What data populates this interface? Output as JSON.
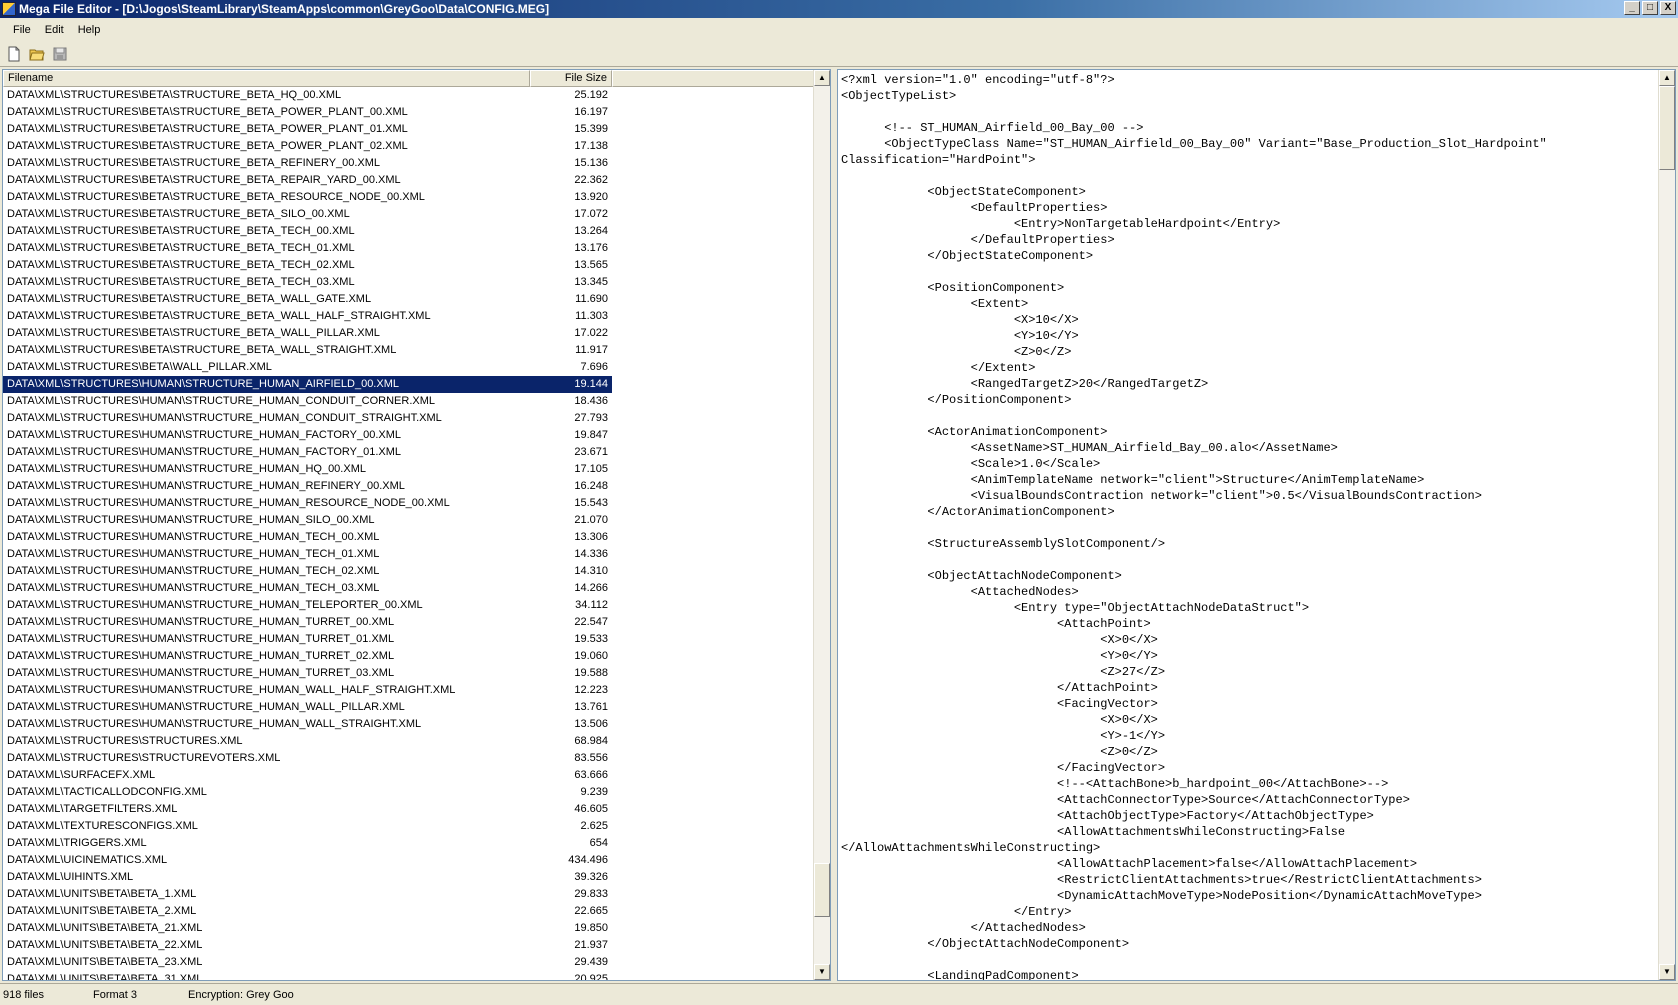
{
  "window": {
    "title": "Mega File Editor - [D:\\Jogos\\SteamLibrary\\SteamApps\\common\\GreyGoo\\Data\\CONFIG.MEG]",
    "controls": [
      "_",
      "□",
      "X"
    ]
  },
  "menu": {
    "file": "File",
    "edit": "Edit",
    "help": "Help"
  },
  "toolbar": {
    "icons": [
      "new-file-icon",
      "open-folder-icon",
      "save-icon"
    ]
  },
  "file_list": {
    "columns": {
      "filename": "Filename",
      "filesize": "File Size"
    },
    "selected_index": 17,
    "rows": [
      {
        "name": "DATA\\XML\\STRUCTURES\\BETA\\STRUCTURE_BETA_HQ_00.XML",
        "size": "25.192"
      },
      {
        "name": "DATA\\XML\\STRUCTURES\\BETA\\STRUCTURE_BETA_POWER_PLANT_00.XML",
        "size": "16.197"
      },
      {
        "name": "DATA\\XML\\STRUCTURES\\BETA\\STRUCTURE_BETA_POWER_PLANT_01.XML",
        "size": "15.399"
      },
      {
        "name": "DATA\\XML\\STRUCTURES\\BETA\\STRUCTURE_BETA_POWER_PLANT_02.XML",
        "size": "17.138"
      },
      {
        "name": "DATA\\XML\\STRUCTURES\\BETA\\STRUCTURE_BETA_REFINERY_00.XML",
        "size": "15.136"
      },
      {
        "name": "DATA\\XML\\STRUCTURES\\BETA\\STRUCTURE_BETA_REPAIR_YARD_00.XML",
        "size": "22.362"
      },
      {
        "name": "DATA\\XML\\STRUCTURES\\BETA\\STRUCTURE_BETA_RESOURCE_NODE_00.XML",
        "size": "13.920"
      },
      {
        "name": "DATA\\XML\\STRUCTURES\\BETA\\STRUCTURE_BETA_SILO_00.XML",
        "size": "17.072"
      },
      {
        "name": "DATA\\XML\\STRUCTURES\\BETA\\STRUCTURE_BETA_TECH_00.XML",
        "size": "13.264"
      },
      {
        "name": "DATA\\XML\\STRUCTURES\\BETA\\STRUCTURE_BETA_TECH_01.XML",
        "size": "13.176"
      },
      {
        "name": "DATA\\XML\\STRUCTURES\\BETA\\STRUCTURE_BETA_TECH_02.XML",
        "size": "13.565"
      },
      {
        "name": "DATA\\XML\\STRUCTURES\\BETA\\STRUCTURE_BETA_TECH_03.XML",
        "size": "13.345"
      },
      {
        "name": "DATA\\XML\\STRUCTURES\\BETA\\STRUCTURE_BETA_WALL_GATE.XML",
        "size": "11.690"
      },
      {
        "name": "DATA\\XML\\STRUCTURES\\BETA\\STRUCTURE_BETA_WALL_HALF_STRAIGHT.XML",
        "size": "11.303"
      },
      {
        "name": "DATA\\XML\\STRUCTURES\\BETA\\STRUCTURE_BETA_WALL_PILLAR.XML",
        "size": "17.022"
      },
      {
        "name": "DATA\\XML\\STRUCTURES\\BETA\\STRUCTURE_BETA_WALL_STRAIGHT.XML",
        "size": "11.917"
      },
      {
        "name": "DATA\\XML\\STRUCTURES\\BETA\\WALL_PILLAR.XML",
        "size": "7.696"
      },
      {
        "name": "DATA\\XML\\STRUCTURES\\HUMAN\\STRUCTURE_HUMAN_AIRFIELD_00.XML",
        "size": "19.144"
      },
      {
        "name": "DATA\\XML\\STRUCTURES\\HUMAN\\STRUCTURE_HUMAN_CONDUIT_CORNER.XML",
        "size": "18.436"
      },
      {
        "name": "DATA\\XML\\STRUCTURES\\HUMAN\\STRUCTURE_HUMAN_CONDUIT_STRAIGHT.XML",
        "size": "27.793"
      },
      {
        "name": "DATA\\XML\\STRUCTURES\\HUMAN\\STRUCTURE_HUMAN_FACTORY_00.XML",
        "size": "19.847"
      },
      {
        "name": "DATA\\XML\\STRUCTURES\\HUMAN\\STRUCTURE_HUMAN_FACTORY_01.XML",
        "size": "23.671"
      },
      {
        "name": "DATA\\XML\\STRUCTURES\\HUMAN\\STRUCTURE_HUMAN_HQ_00.XML",
        "size": "17.105"
      },
      {
        "name": "DATA\\XML\\STRUCTURES\\HUMAN\\STRUCTURE_HUMAN_REFINERY_00.XML",
        "size": "16.248"
      },
      {
        "name": "DATA\\XML\\STRUCTURES\\HUMAN\\STRUCTURE_HUMAN_RESOURCE_NODE_00.XML",
        "size": "15.543"
      },
      {
        "name": "DATA\\XML\\STRUCTURES\\HUMAN\\STRUCTURE_HUMAN_SILO_00.XML",
        "size": "21.070"
      },
      {
        "name": "DATA\\XML\\STRUCTURES\\HUMAN\\STRUCTURE_HUMAN_TECH_00.XML",
        "size": "13.306"
      },
      {
        "name": "DATA\\XML\\STRUCTURES\\HUMAN\\STRUCTURE_HUMAN_TECH_01.XML",
        "size": "14.336"
      },
      {
        "name": "DATA\\XML\\STRUCTURES\\HUMAN\\STRUCTURE_HUMAN_TECH_02.XML",
        "size": "14.310"
      },
      {
        "name": "DATA\\XML\\STRUCTURES\\HUMAN\\STRUCTURE_HUMAN_TECH_03.XML",
        "size": "14.266"
      },
      {
        "name": "DATA\\XML\\STRUCTURES\\HUMAN\\STRUCTURE_HUMAN_TELEPORTER_00.XML",
        "size": "34.112"
      },
      {
        "name": "DATA\\XML\\STRUCTURES\\HUMAN\\STRUCTURE_HUMAN_TURRET_00.XML",
        "size": "22.547"
      },
      {
        "name": "DATA\\XML\\STRUCTURES\\HUMAN\\STRUCTURE_HUMAN_TURRET_01.XML",
        "size": "19.533"
      },
      {
        "name": "DATA\\XML\\STRUCTURES\\HUMAN\\STRUCTURE_HUMAN_TURRET_02.XML",
        "size": "19.060"
      },
      {
        "name": "DATA\\XML\\STRUCTURES\\HUMAN\\STRUCTURE_HUMAN_TURRET_03.XML",
        "size": "19.588"
      },
      {
        "name": "DATA\\XML\\STRUCTURES\\HUMAN\\STRUCTURE_HUMAN_WALL_HALF_STRAIGHT.XML",
        "size": "12.223"
      },
      {
        "name": "DATA\\XML\\STRUCTURES\\HUMAN\\STRUCTURE_HUMAN_WALL_PILLAR.XML",
        "size": "13.761"
      },
      {
        "name": "DATA\\XML\\STRUCTURES\\HUMAN\\STRUCTURE_HUMAN_WALL_STRAIGHT.XML",
        "size": "13.506"
      },
      {
        "name": "DATA\\XML\\STRUCTURES\\STRUCTURES.XML",
        "size": "68.984"
      },
      {
        "name": "DATA\\XML\\STRUCTURES\\STRUCTUREVOTERS.XML",
        "size": "83.556"
      },
      {
        "name": "DATA\\XML\\SURFACEFX.XML",
        "size": "63.666"
      },
      {
        "name": "DATA\\XML\\TACTICALLODCONFIG.XML",
        "size": "9.239"
      },
      {
        "name": "DATA\\XML\\TARGETFILTERS.XML",
        "size": "46.605"
      },
      {
        "name": "DATA\\XML\\TEXTURESCONFIGS.XML",
        "size": "2.625"
      },
      {
        "name": "DATA\\XML\\TRIGGERS.XML",
        "size": "654"
      },
      {
        "name": "DATA\\XML\\UICINEMATICS.XML",
        "size": "434.496"
      },
      {
        "name": "DATA\\XML\\UIHINTS.XML",
        "size": "39.326"
      },
      {
        "name": "DATA\\XML\\UNITS\\BETA\\BETA_1.XML",
        "size": "29.833"
      },
      {
        "name": "DATA\\XML\\UNITS\\BETA\\BETA_2.XML",
        "size": "22.665"
      },
      {
        "name": "DATA\\XML\\UNITS\\BETA\\BETA_21.XML",
        "size": "19.850"
      },
      {
        "name": "DATA\\XML\\UNITS\\BETA\\BETA_22.XML",
        "size": "21.937"
      },
      {
        "name": "DATA\\XML\\UNITS\\BETA\\BETA_23.XML",
        "size": "29.439"
      },
      {
        "name": "DATA\\XML\\UNITS\\BETA\\BETA_31.XML",
        "size": "20.925"
      }
    ]
  },
  "editor": {
    "lines": [
      "<?xml version=\"1.0\" encoding=\"utf-8\"?>",
      "<ObjectTypeList>",
      "",
      "      <!-- ST_HUMAN_Airfield_00_Bay_00 -->",
      "      <ObjectTypeClass Name=\"ST_HUMAN_Airfield_00_Bay_00\" Variant=\"Base_Production_Slot_Hardpoint\"",
      "Classification=\"HardPoint\">",
      "",
      "            <ObjectStateComponent>",
      "                  <DefaultProperties>",
      "                        <Entry>NonTargetableHardpoint</Entry>",
      "                  </DefaultProperties>",
      "            </ObjectStateComponent>",
      "",
      "            <PositionComponent>",
      "                  <Extent>",
      "                        <X>10</X>",
      "                        <Y>10</Y>",
      "                        <Z>0</Z>",
      "                  </Extent>",
      "                  <RangedTargetZ>20</RangedTargetZ>",
      "            </PositionComponent>",
      "",
      "            <ActorAnimationComponent>",
      "                  <AssetName>ST_HUMAN_Airfield_Bay_00.alo</AssetName>",
      "                  <Scale>1.0</Scale>",
      "                  <AnimTemplateName network=\"client\">Structure</AnimTemplateName>",
      "                  <VisualBoundsContraction network=\"client\">0.5</VisualBoundsContraction>",
      "            </ActorAnimationComponent>",
      "",
      "            <StructureAssemblySlotComponent/>",
      "",
      "            <ObjectAttachNodeComponent>",
      "                  <AttachedNodes>",
      "                        <Entry type=\"ObjectAttachNodeDataStruct\">",
      "                              <AttachPoint>",
      "                                    <X>0</X>",
      "                                    <Y>0</Y>",
      "                                    <Z>27</Z>",
      "                              </AttachPoint>",
      "                              <FacingVector>",
      "                                    <X>0</X>",
      "                                    <Y>-1</Y>",
      "                                    <Z>0</Z>",
      "                              </FacingVector>",
      "                              <!--<AttachBone>b_hardpoint_00</AttachBone>-->",
      "                              <AttachConnectorType>Source</AttachConnectorType>",
      "                              <AttachObjectType>Factory</AttachObjectType>",
      "                              <AllowAttachmentsWhileConstructing>False",
      "</AllowAttachmentsWhileConstructing>",
      "                              <AllowAttachPlacement>false</AllowAttachPlacement>",
      "                              <RestrictClientAttachments>true</RestrictClientAttachments>",
      "                              <DynamicAttachMoveType>NodePosition</DynamicAttachMoveType>",
      "                        </Entry>",
      "                  </AttachedNodes>",
      "            </ObjectAttachNodeComponent>",
      "",
      "            <LandingPadComponent>"
    ]
  },
  "status": {
    "file_count": "918 files",
    "format": "Format 3",
    "encryption": "Encryption: Grey Goo"
  }
}
